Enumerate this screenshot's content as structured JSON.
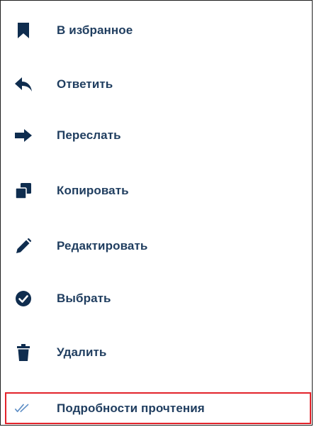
{
  "colors": {
    "text": "#1f3d5f",
    "icon": "#0f2d4f",
    "check_icon": "#5f8fc6",
    "highlight_border": "#e3232b",
    "frame_border": "#1f1f1f"
  },
  "menu": {
    "items": [
      {
        "id": "favorite",
        "label": "В избранное",
        "icon": "bookmark-icon"
      },
      {
        "id": "reply",
        "label": "Ответить",
        "icon": "reply-icon"
      },
      {
        "id": "forward",
        "label": "Переслать",
        "icon": "forward-arrow-icon"
      },
      {
        "id": "copy",
        "label": "Копировать",
        "icon": "copy-icon"
      },
      {
        "id": "edit",
        "label": "Редактировать",
        "icon": "pencil-icon"
      },
      {
        "id": "select",
        "label": "Выбрать",
        "icon": "check-circle-icon"
      },
      {
        "id": "delete",
        "label": "Удалить",
        "icon": "trash-icon"
      },
      {
        "id": "read-details",
        "label": "Подробности прочтения",
        "icon": "double-check-icon",
        "highlighted": true
      }
    ]
  }
}
